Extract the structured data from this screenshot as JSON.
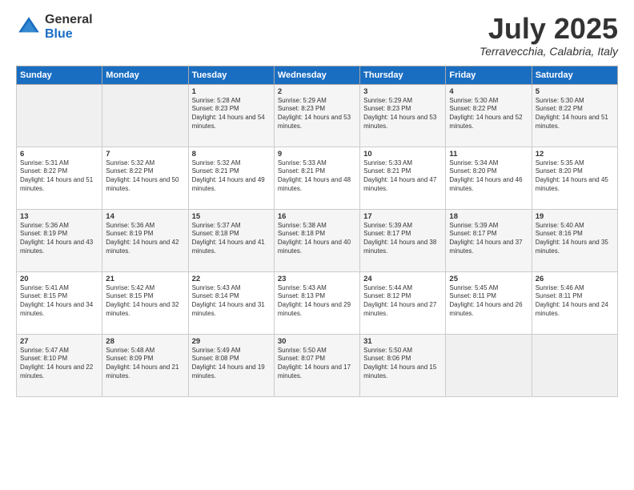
{
  "logo": {
    "general": "General",
    "blue": "Blue"
  },
  "title": {
    "month": "July 2025",
    "location": "Terravecchia, Calabria, Italy"
  },
  "headers": [
    "Sunday",
    "Monday",
    "Tuesday",
    "Wednesday",
    "Thursday",
    "Friday",
    "Saturday"
  ],
  "weeks": [
    [
      {
        "day": "",
        "sunrise": "",
        "sunset": "",
        "daylight": ""
      },
      {
        "day": "",
        "sunrise": "",
        "sunset": "",
        "daylight": ""
      },
      {
        "day": "1",
        "sunrise": "Sunrise: 5:28 AM",
        "sunset": "Sunset: 8:23 PM",
        "daylight": "Daylight: 14 hours and 54 minutes."
      },
      {
        "day": "2",
        "sunrise": "Sunrise: 5:29 AM",
        "sunset": "Sunset: 8:23 PM",
        "daylight": "Daylight: 14 hours and 53 minutes."
      },
      {
        "day": "3",
        "sunrise": "Sunrise: 5:29 AM",
        "sunset": "Sunset: 8:23 PM",
        "daylight": "Daylight: 14 hours and 53 minutes."
      },
      {
        "day": "4",
        "sunrise": "Sunrise: 5:30 AM",
        "sunset": "Sunset: 8:22 PM",
        "daylight": "Daylight: 14 hours and 52 minutes."
      },
      {
        "day": "5",
        "sunrise": "Sunrise: 5:30 AM",
        "sunset": "Sunset: 8:22 PM",
        "daylight": "Daylight: 14 hours and 51 minutes."
      }
    ],
    [
      {
        "day": "6",
        "sunrise": "Sunrise: 5:31 AM",
        "sunset": "Sunset: 8:22 PM",
        "daylight": "Daylight: 14 hours and 51 minutes."
      },
      {
        "day": "7",
        "sunrise": "Sunrise: 5:32 AM",
        "sunset": "Sunset: 8:22 PM",
        "daylight": "Daylight: 14 hours and 50 minutes."
      },
      {
        "day": "8",
        "sunrise": "Sunrise: 5:32 AM",
        "sunset": "Sunset: 8:21 PM",
        "daylight": "Daylight: 14 hours and 49 minutes."
      },
      {
        "day": "9",
        "sunrise": "Sunrise: 5:33 AM",
        "sunset": "Sunset: 8:21 PM",
        "daylight": "Daylight: 14 hours and 48 minutes."
      },
      {
        "day": "10",
        "sunrise": "Sunrise: 5:33 AM",
        "sunset": "Sunset: 8:21 PM",
        "daylight": "Daylight: 14 hours and 47 minutes."
      },
      {
        "day": "11",
        "sunrise": "Sunrise: 5:34 AM",
        "sunset": "Sunset: 8:20 PM",
        "daylight": "Daylight: 14 hours and 46 minutes."
      },
      {
        "day": "12",
        "sunrise": "Sunrise: 5:35 AM",
        "sunset": "Sunset: 8:20 PM",
        "daylight": "Daylight: 14 hours and 45 minutes."
      }
    ],
    [
      {
        "day": "13",
        "sunrise": "Sunrise: 5:36 AM",
        "sunset": "Sunset: 8:19 PM",
        "daylight": "Daylight: 14 hours and 43 minutes."
      },
      {
        "day": "14",
        "sunrise": "Sunrise: 5:36 AM",
        "sunset": "Sunset: 8:19 PM",
        "daylight": "Daylight: 14 hours and 42 minutes."
      },
      {
        "day": "15",
        "sunrise": "Sunrise: 5:37 AM",
        "sunset": "Sunset: 8:18 PM",
        "daylight": "Daylight: 14 hours and 41 minutes."
      },
      {
        "day": "16",
        "sunrise": "Sunrise: 5:38 AM",
        "sunset": "Sunset: 8:18 PM",
        "daylight": "Daylight: 14 hours and 40 minutes."
      },
      {
        "day": "17",
        "sunrise": "Sunrise: 5:39 AM",
        "sunset": "Sunset: 8:17 PM",
        "daylight": "Daylight: 14 hours and 38 minutes."
      },
      {
        "day": "18",
        "sunrise": "Sunrise: 5:39 AM",
        "sunset": "Sunset: 8:17 PM",
        "daylight": "Daylight: 14 hours and 37 minutes."
      },
      {
        "day": "19",
        "sunrise": "Sunrise: 5:40 AM",
        "sunset": "Sunset: 8:16 PM",
        "daylight": "Daylight: 14 hours and 35 minutes."
      }
    ],
    [
      {
        "day": "20",
        "sunrise": "Sunrise: 5:41 AM",
        "sunset": "Sunset: 8:15 PM",
        "daylight": "Daylight: 14 hours and 34 minutes."
      },
      {
        "day": "21",
        "sunrise": "Sunrise: 5:42 AM",
        "sunset": "Sunset: 8:15 PM",
        "daylight": "Daylight: 14 hours and 32 minutes."
      },
      {
        "day": "22",
        "sunrise": "Sunrise: 5:43 AM",
        "sunset": "Sunset: 8:14 PM",
        "daylight": "Daylight: 14 hours and 31 minutes."
      },
      {
        "day": "23",
        "sunrise": "Sunrise: 5:43 AM",
        "sunset": "Sunset: 8:13 PM",
        "daylight": "Daylight: 14 hours and 29 minutes."
      },
      {
        "day": "24",
        "sunrise": "Sunrise: 5:44 AM",
        "sunset": "Sunset: 8:12 PM",
        "daylight": "Daylight: 14 hours and 27 minutes."
      },
      {
        "day": "25",
        "sunrise": "Sunrise: 5:45 AM",
        "sunset": "Sunset: 8:11 PM",
        "daylight": "Daylight: 14 hours and 26 minutes."
      },
      {
        "day": "26",
        "sunrise": "Sunrise: 5:46 AM",
        "sunset": "Sunset: 8:11 PM",
        "daylight": "Daylight: 14 hours and 24 minutes."
      }
    ],
    [
      {
        "day": "27",
        "sunrise": "Sunrise: 5:47 AM",
        "sunset": "Sunset: 8:10 PM",
        "daylight": "Daylight: 14 hours and 22 minutes."
      },
      {
        "day": "28",
        "sunrise": "Sunrise: 5:48 AM",
        "sunset": "Sunset: 8:09 PM",
        "daylight": "Daylight: 14 hours and 21 minutes."
      },
      {
        "day": "29",
        "sunrise": "Sunrise: 5:49 AM",
        "sunset": "Sunset: 8:08 PM",
        "daylight": "Daylight: 14 hours and 19 minutes."
      },
      {
        "day": "30",
        "sunrise": "Sunrise: 5:50 AM",
        "sunset": "Sunset: 8:07 PM",
        "daylight": "Daylight: 14 hours and 17 minutes."
      },
      {
        "day": "31",
        "sunrise": "Sunrise: 5:50 AM",
        "sunset": "Sunset: 8:06 PM",
        "daylight": "Daylight: 14 hours and 15 minutes."
      },
      {
        "day": "",
        "sunrise": "",
        "sunset": "",
        "daylight": ""
      },
      {
        "day": "",
        "sunrise": "",
        "sunset": "",
        "daylight": ""
      }
    ]
  ]
}
